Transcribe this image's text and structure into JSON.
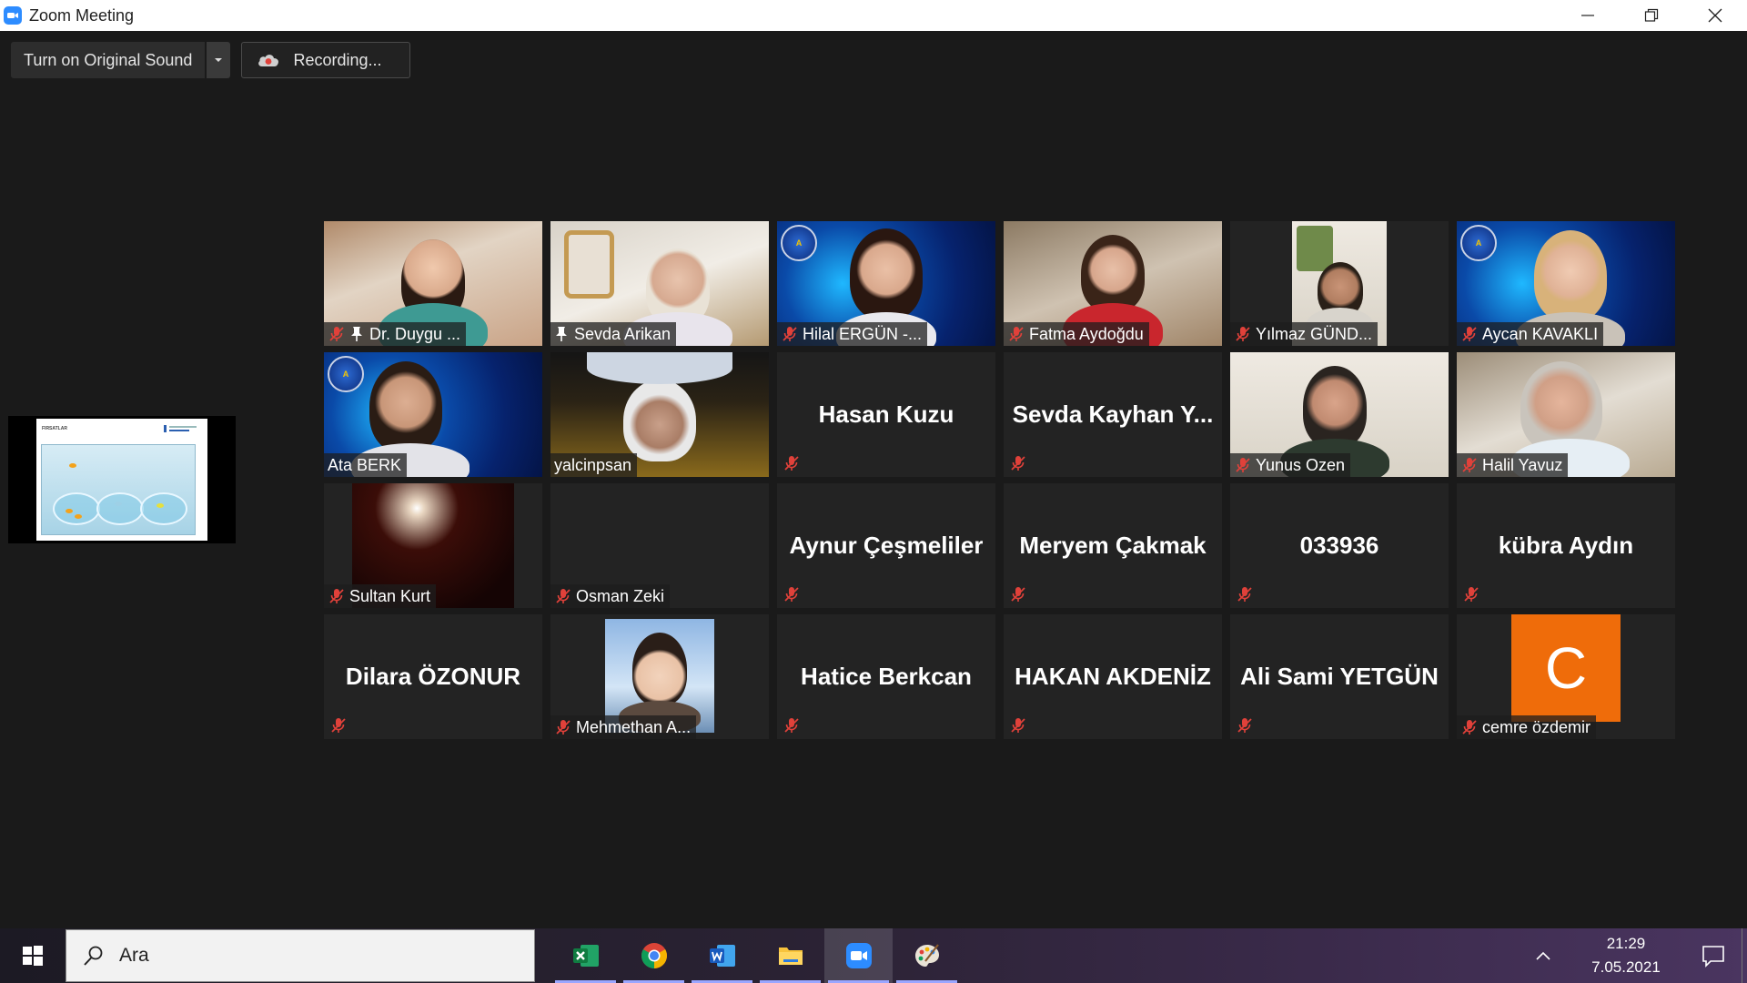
{
  "window": {
    "title": "Zoom Meeting"
  },
  "toolbar": {
    "original_sound_label": "Turn on Original Sound",
    "recording_label": "Recording..."
  },
  "shared_screen": {
    "slide_title": "FIRSATLAR"
  },
  "participants": [
    {
      "name": "Dr. Duygu ...",
      "type": "video",
      "muted": true,
      "pinned": true
    },
    {
      "name": "Sevda Arikan",
      "type": "video",
      "muted": false,
      "pinned": true
    },
    {
      "name": "Hilal ERGÜN -...",
      "type": "video",
      "muted": true,
      "pinned": false
    },
    {
      "name": "Fatma Aydoğdu",
      "type": "video",
      "muted": true,
      "pinned": false
    },
    {
      "name": "Yılmaz GÜND...",
      "type": "video",
      "muted": true,
      "pinned": false
    },
    {
      "name": "Aycan KAVAKLI",
      "type": "video",
      "muted": true,
      "pinned": false
    },
    {
      "name": "Ata BERK",
      "type": "video",
      "muted": false,
      "pinned": false
    },
    {
      "name": "yalcinpsan",
      "type": "video",
      "muted": false,
      "pinned": false,
      "active_speaker": true
    },
    {
      "name": "Hasan Kuzu",
      "type": "name",
      "muted": true
    },
    {
      "name": "Sevda Kayhan Y...",
      "type": "name",
      "muted": true
    },
    {
      "name": "Yunus Ozen",
      "type": "video",
      "muted": true,
      "pinned": false
    },
    {
      "name": "Halil Yavuz",
      "type": "video",
      "muted": true,
      "pinned": false
    },
    {
      "name": "Sultan Kurt",
      "type": "video",
      "muted": true,
      "pinned": false
    },
    {
      "name": "Osman Zeki",
      "type": "label",
      "muted": true
    },
    {
      "name": "Aynur Çeşmeliler",
      "type": "name",
      "muted": true
    },
    {
      "name": "Meryem Çakmak",
      "type": "name",
      "muted": true
    },
    {
      "name": "033936",
      "type": "name",
      "muted": true
    },
    {
      "name": "kübra Aydın",
      "type": "name",
      "muted": true
    },
    {
      "name": "Dilara ÖZONUR",
      "type": "name",
      "muted": true
    },
    {
      "name": "Mehmethan A...",
      "type": "avatar",
      "muted": true
    },
    {
      "name": "Hatice Berkcan",
      "type": "name",
      "muted": true
    },
    {
      "name": "HAKAN AKDENİZ",
      "type": "name",
      "muted": true
    },
    {
      "name": "Ali Sami YETGÜN",
      "type": "name",
      "muted": true
    },
    {
      "name": "cemre özdemir",
      "type": "avatar-letter",
      "letter": "C",
      "muted": true
    }
  ],
  "taskbar": {
    "search_placeholder": "Ara",
    "apps": [
      "excel-icon",
      "chrome-icon",
      "word-icon",
      "file-explorer-icon",
      "zoom-icon",
      "paint-icon"
    ],
    "time": "21:29",
    "date": "7.05.2021"
  },
  "colors": {
    "active_speaker_border": "#c9d66a",
    "mute_red": "#e0413a",
    "zoom_blue": "#2d8cff",
    "avatar_orange": "#ef6c0a"
  }
}
